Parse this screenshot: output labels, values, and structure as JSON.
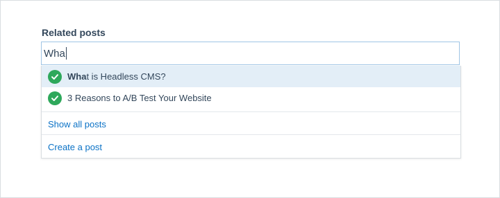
{
  "field": {
    "label": "Related posts",
    "value": "Wha"
  },
  "results": [
    {
      "match": "Wha",
      "rest": "t is Headless CMS?",
      "icon": "check-circle-icon",
      "highlighted": true
    },
    {
      "match": "",
      "rest": "3 Reasons to A/B Test Your Website",
      "icon": "check-circle-icon",
      "highlighted": false
    }
  ],
  "links": {
    "show_all": "Show all posts",
    "create": "Create a post"
  },
  "colors": {
    "accent": "#0b72c6",
    "success": "#2ea85b",
    "highlight": "#e3eef7"
  }
}
